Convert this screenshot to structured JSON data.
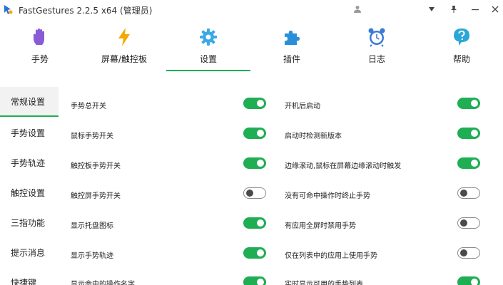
{
  "window": {
    "title": "FastGestures 2.2.5 x64  (管理员)"
  },
  "nav": {
    "tabs": [
      {
        "label": "手势",
        "icon": "hand-icon",
        "color": "#8a5bd6"
      },
      {
        "label": "屏幕/触控板",
        "icon": "lightning-icon",
        "color": "#f2a900"
      },
      {
        "label": "设置",
        "icon": "gear-icon",
        "color": "#3aa9e6",
        "active": true
      },
      {
        "label": "插件",
        "icon": "puzzle-icon",
        "color": "#2b8fd8"
      },
      {
        "label": "日志",
        "icon": "alarm-clock-icon",
        "color": "#3a7bd5"
      },
      {
        "label": "帮助",
        "icon": "help-icon",
        "color": "#2aa7d8"
      }
    ]
  },
  "sidebar": {
    "items": [
      {
        "label": "常规设置",
        "active": true
      },
      {
        "label": "手势设置"
      },
      {
        "label": "手势轨迹"
      },
      {
        "label": "触控设置"
      },
      {
        "label": "三指功能"
      },
      {
        "label": "提示消息"
      },
      {
        "label": "快捷键"
      }
    ]
  },
  "settings": {
    "left": [
      {
        "label": "手势总开关",
        "on": true
      },
      {
        "label": "鼠标手势开关",
        "on": true
      },
      {
        "label": "触控板手势开关",
        "on": true
      },
      {
        "label": "触控屏手势开关",
        "on": false
      },
      {
        "label": "显示托盘图标",
        "on": true
      },
      {
        "label": "显示手势轨迹",
        "on": true
      },
      {
        "label": "显示命中的操作名字",
        "on": true
      }
    ],
    "right": [
      {
        "label": "开机后启动",
        "on": true
      },
      {
        "label": "启动时检测新版本",
        "on": true
      },
      {
        "label": "边缘滚动,鼠标在屏幕边缘滚动时触发",
        "on": true
      },
      {
        "label": "没有可命中操作时终止手势",
        "on": false
      },
      {
        "label": "有应用全屏时禁用手势",
        "on": false
      },
      {
        "label": "仅在列表中的应用上使用手势",
        "on": false
      },
      {
        "label": "实时显示可用的手势列表",
        "on": true
      }
    ]
  },
  "colors": {
    "accent": "#1fae54"
  }
}
